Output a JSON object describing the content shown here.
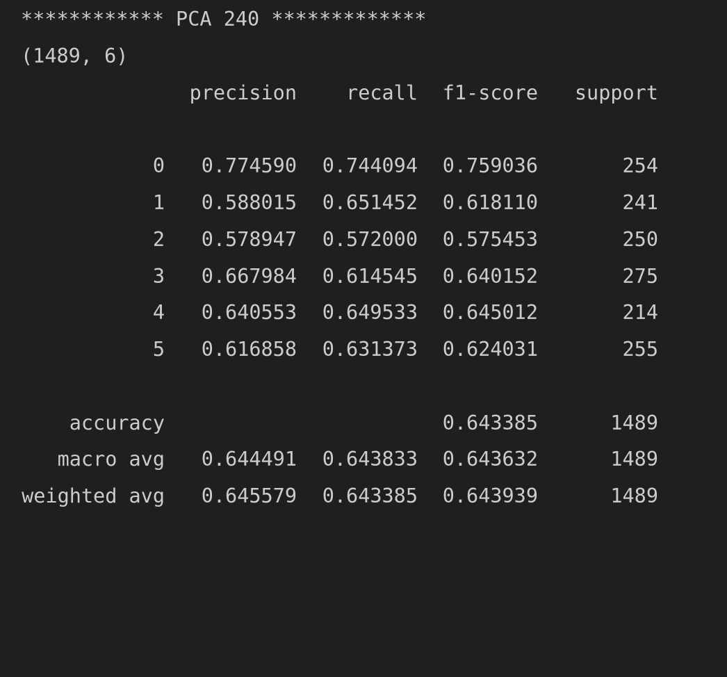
{
  "header": {
    "banner": "************ PCA 240 *************",
    "shape": "(1489, 6)"
  },
  "report": {
    "columns": [
      "precision",
      "recall",
      "f1-score",
      "support"
    ],
    "classes": [
      {
        "label": "0",
        "precision": "0.774590",
        "recall": "0.744094",
        "f1": "0.759036",
        "support": "254"
      },
      {
        "label": "1",
        "precision": "0.588015",
        "recall": "0.651452",
        "f1": "0.618110",
        "support": "241"
      },
      {
        "label": "2",
        "precision": "0.578947",
        "recall": "0.572000",
        "f1": "0.575453",
        "support": "250"
      },
      {
        "label": "3",
        "precision": "0.667984",
        "recall": "0.614545",
        "f1": "0.640152",
        "support": "275"
      },
      {
        "label": "4",
        "precision": "0.640553",
        "recall": "0.649533",
        "f1": "0.645012",
        "support": "214"
      },
      {
        "label": "5",
        "precision": "0.616858",
        "recall": "0.631373",
        "f1": "0.624031",
        "support": "255"
      }
    ],
    "summary": [
      {
        "label": "accuracy",
        "precision": "",
        "recall": "",
        "f1": "0.643385",
        "support": "1489"
      },
      {
        "label": "macro avg",
        "precision": "0.644491",
        "recall": "0.643833",
        "f1": "0.643632",
        "support": "1489"
      },
      {
        "label": "weighted avg",
        "precision": "0.645579",
        "recall": "0.643385",
        "f1": "0.643939",
        "support": "1489"
      }
    ]
  }
}
